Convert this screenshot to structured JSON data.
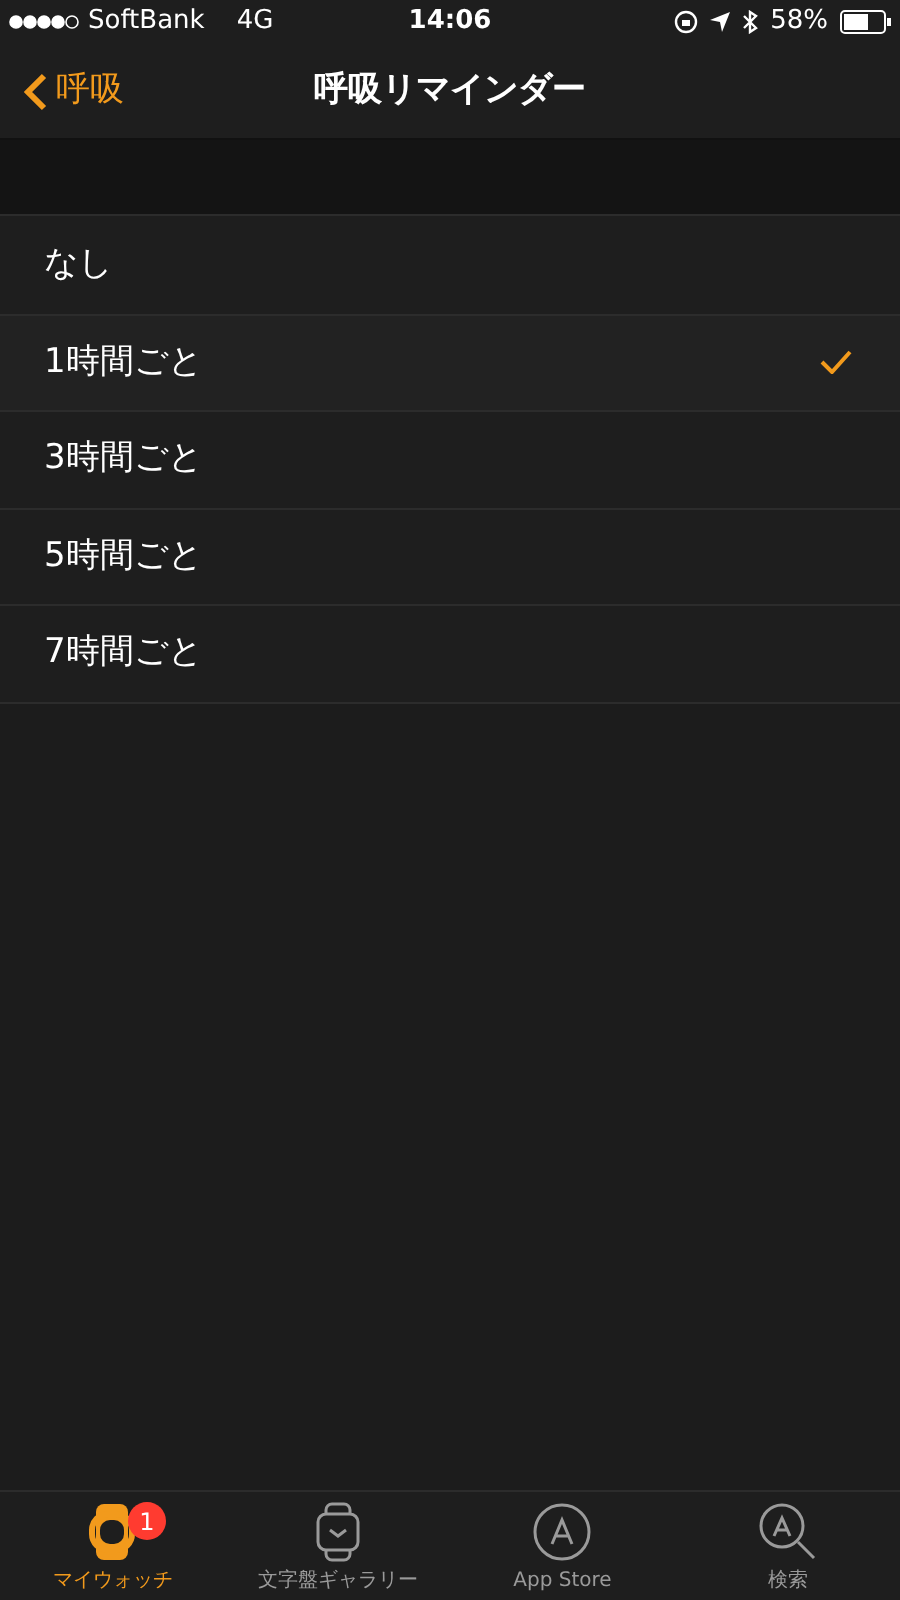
{
  "status_bar": {
    "carrier": "SoftBank",
    "network": "4G",
    "time": "14:06",
    "battery": "58%"
  },
  "nav": {
    "back": "呼吸",
    "title": "呼吸リマインダー"
  },
  "options": [
    {
      "label": "なし",
      "selected": false
    },
    {
      "label": "1時間ごと",
      "selected": true
    },
    {
      "label": "3時間ごと",
      "selected": false
    },
    {
      "label": "5時間ごと",
      "selected": false
    },
    {
      "label": "7時間ごと",
      "selected": false
    }
  ],
  "tabs": [
    {
      "kind": "watch",
      "label": "マイウォッチ",
      "selected": true,
      "badge": "1"
    },
    {
      "kind": "faces",
      "label": "文字盤ギャラリー",
      "selected": false
    },
    {
      "kind": "store",
      "label": "App Store",
      "selected": false
    },
    {
      "kind": "search",
      "label": "検索",
      "selected": false
    }
  ]
}
